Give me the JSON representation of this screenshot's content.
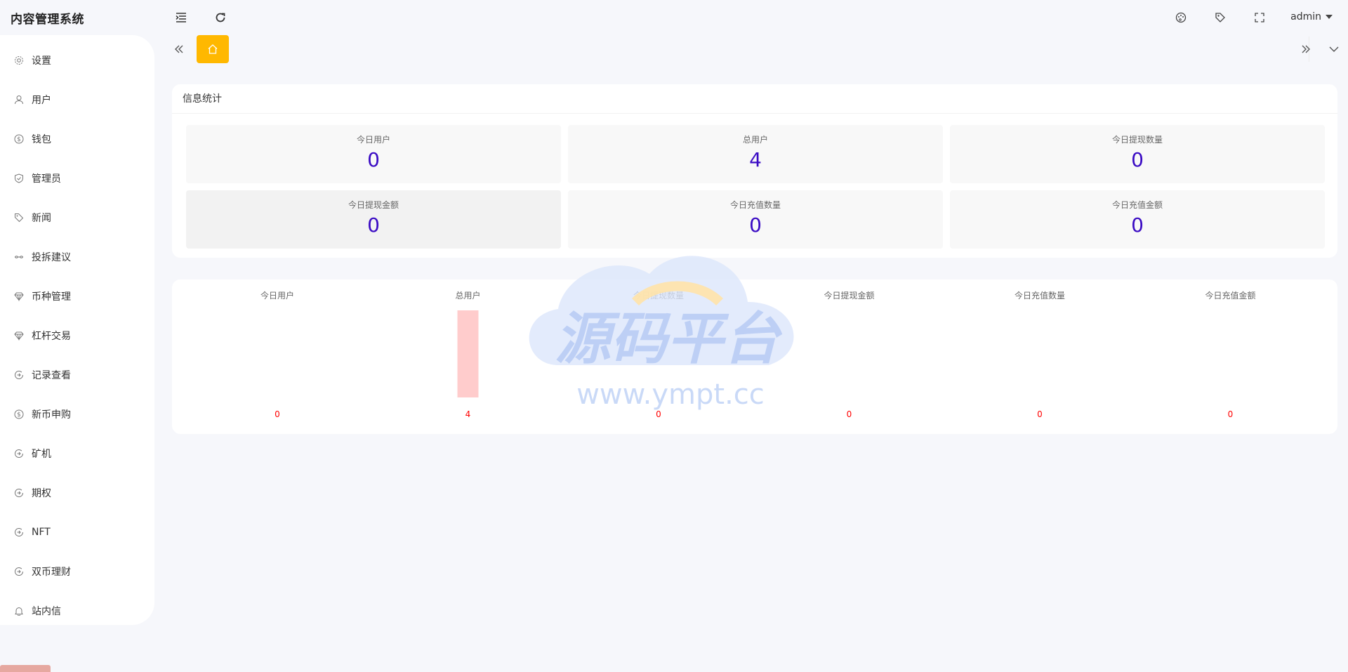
{
  "app": {
    "title": "内容管理系统"
  },
  "header": {
    "user": "admin",
    "icons": [
      "menu-fold-icon",
      "refresh-icon",
      "theme-icon",
      "tag-icon",
      "fullscreen-icon"
    ]
  },
  "sidebar": {
    "items": [
      {
        "label": "设置",
        "icon": "gear-icon"
      },
      {
        "label": "用户",
        "icon": "user-icon"
      },
      {
        "label": "钱包",
        "icon": "dollar-icon"
      },
      {
        "label": "管理员",
        "icon": "shield-icon"
      },
      {
        "label": "新闻",
        "icon": "tag-icon"
      },
      {
        "label": "投拆建议",
        "icon": "link-icon"
      },
      {
        "label": "币种管理",
        "icon": "diamond-icon"
      },
      {
        "label": "杠杆交易",
        "icon": "diamond-icon"
      },
      {
        "label": "记录查看",
        "icon": "circle-icon"
      },
      {
        "label": "新币申购",
        "icon": "dollar-icon"
      },
      {
        "label": "矿机",
        "icon": "circle-icon"
      },
      {
        "label": "期权",
        "icon": "circle-icon"
      },
      {
        "label": "NFT",
        "icon": "circle-icon"
      },
      {
        "label": "双币理财",
        "icon": "circle-icon"
      },
      {
        "label": "站内信",
        "icon": "bell-icon"
      }
    ]
  },
  "tabs": {
    "home_icon": "home-icon"
  },
  "stats": {
    "title": "信息统计",
    "cards": [
      {
        "label": "今日用户",
        "value": "0"
      },
      {
        "label": "总用户",
        "value": "4"
      },
      {
        "label": "今日提现数量",
        "value": "0"
      },
      {
        "label": "今日提现金额",
        "value": "0"
      },
      {
        "label": "今日充值数量",
        "value": "0"
      },
      {
        "label": "今日充值金额",
        "value": "0"
      }
    ]
  },
  "watermark": {
    "text_cn": "源码平台",
    "text_url": "www.ympt.cc"
  },
  "colors": {
    "accent": "#ffb800",
    "value": "#3b0cc4",
    "bar": "#ffcccc",
    "bar_label": "#ff0000"
  },
  "chart_data": {
    "type": "bar",
    "categories": [
      "今日用户",
      "总用户",
      "今日提现数量",
      "今日提现金额",
      "今日充值数量",
      "今日充值金额"
    ],
    "values": [
      0,
      4,
      0,
      0,
      0,
      0
    ],
    "ylim": [
      0,
      4
    ],
    "grid": false,
    "legend": "none"
  }
}
